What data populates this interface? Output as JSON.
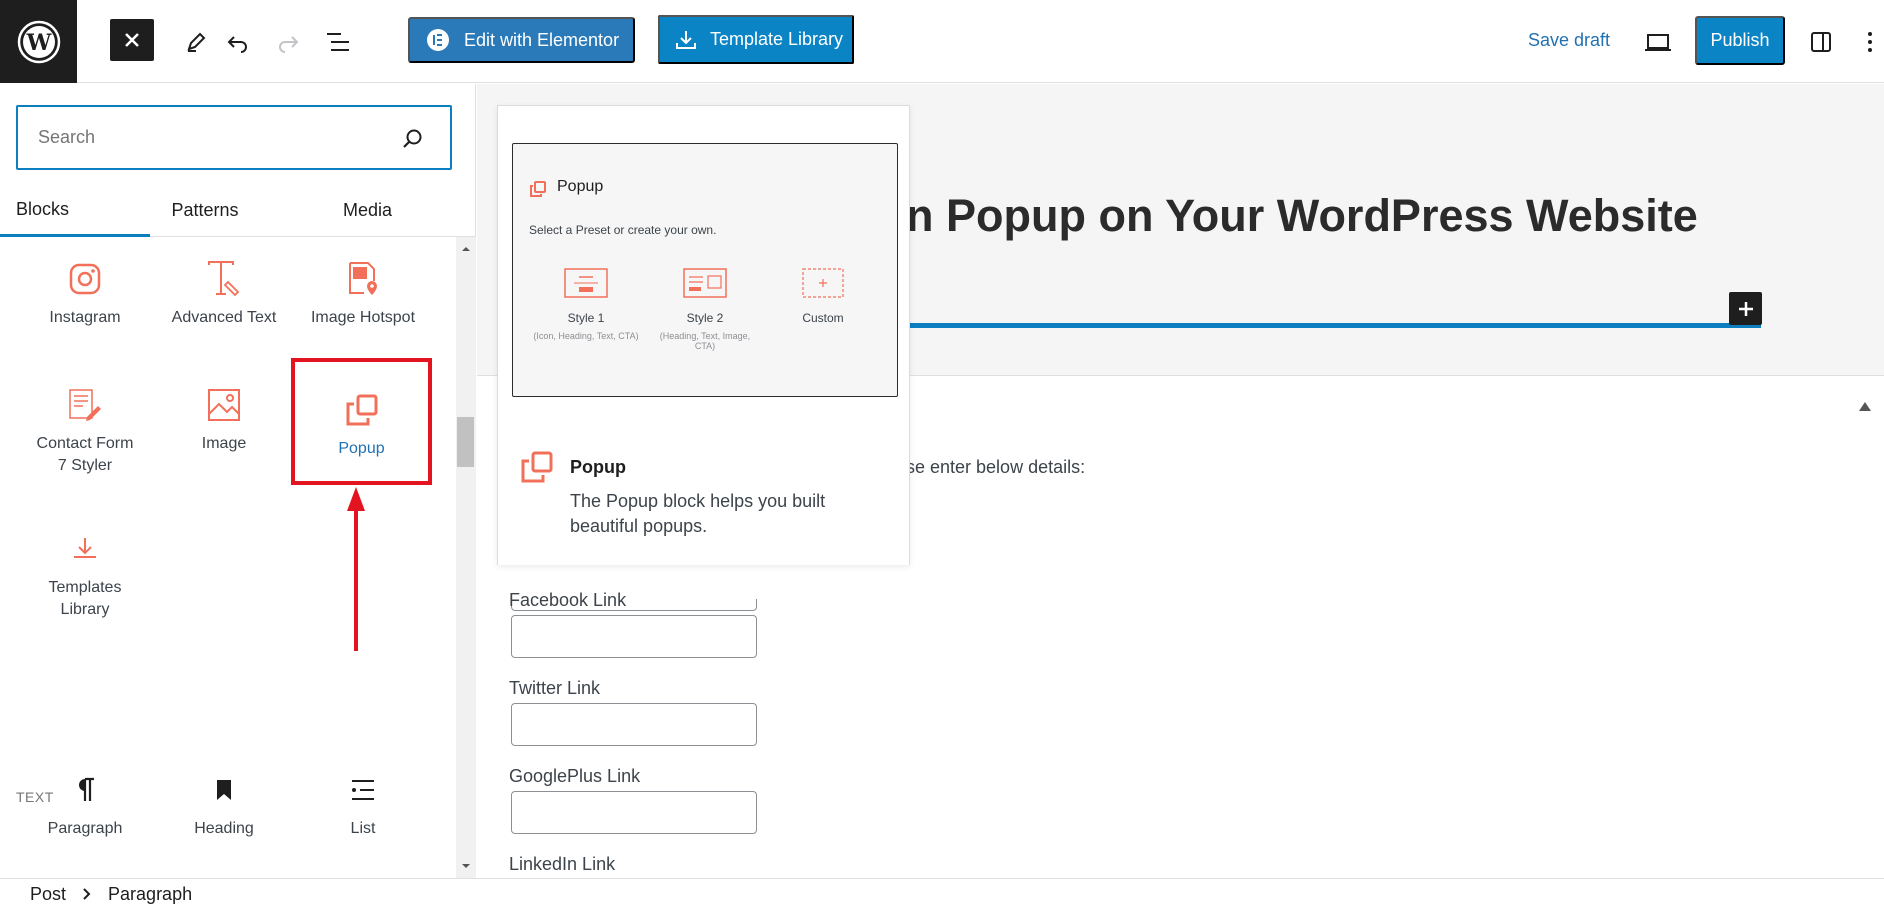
{
  "toolbar": {
    "elementor_label": "Edit with Elementor",
    "template_library_label": "Template Library",
    "save_draft_label": "Save draft",
    "publish_label": "Publish"
  },
  "inserter": {
    "search_placeholder": "Search",
    "tabs": [
      "Blocks",
      "Patterns",
      "Media"
    ],
    "blocks": [
      {
        "label": "Instagram",
        "icon": "instagram-icon"
      },
      {
        "label": "Advanced Text",
        "icon": "advanced-text-icon"
      },
      {
        "label": "Image Hotspot",
        "icon": "image-hotspot-icon"
      },
      {
        "label": "Contact Form\n7 Styler",
        "icon": "contact-form-icon"
      },
      {
        "label": "Image",
        "icon": "image-icon"
      },
      {
        "label": "Popup",
        "icon": "popup-icon"
      },
      {
        "label": "Templates\nLibrary",
        "icon": "download-icon"
      }
    ],
    "section_text": "TEXT",
    "text_blocks": [
      {
        "label": "Paragraph",
        "icon": "paragraph-icon"
      },
      {
        "label": "Heading",
        "icon": "bookmark-icon"
      },
      {
        "label": "List",
        "icon": "list-icon"
      }
    ]
  },
  "preview": {
    "frame_title": "Popup",
    "frame_subtitle": "Select a Preset or create your own.",
    "options": [
      {
        "name": "Style 1",
        "desc": "(Icon, Heading, Text, CTA)"
      },
      {
        "name": "Style 2",
        "desc": "(Heading, Text, Image, CTA)"
      },
      {
        "name": "Custom",
        "desc": ""
      }
    ],
    "info_title": "Popup",
    "info_desc": "The Popup block helps you built beautiful popups."
  },
  "canvas": {
    "hero_title": "n Popup on Your WordPress Website",
    "form_intro": "se enter below details:",
    "fields": [
      "Facebook Link",
      "Twitter Link",
      "GooglePlus Link",
      "LinkedIn Link"
    ]
  },
  "breadcrumb": {
    "items": [
      "Post",
      "Paragraph"
    ]
  },
  "colors": {
    "accent": "#0b7fc0",
    "elementor": "#2a79b8",
    "block_icon": "#f2705a",
    "highlight": "#e3141f"
  }
}
